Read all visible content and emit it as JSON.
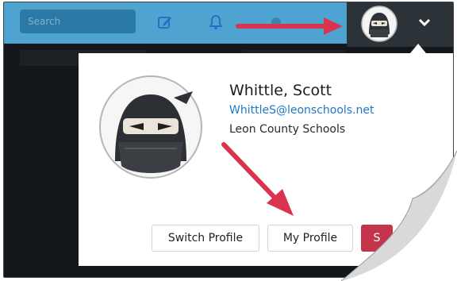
{
  "topbar": {
    "search_placeholder": "Search"
  },
  "profile": {
    "name": "Whittle, Scott",
    "email": "WhittleS@leonschools.net",
    "organization": "Leon County Schools"
  },
  "buttons": {
    "switch_profile": "Switch Profile",
    "my_profile": "My Profile",
    "third": "S"
  },
  "icons": [
    "edit-icon",
    "bell-icon",
    "chevron-down-icon"
  ],
  "colors": {
    "topbar": "#4fa3d1",
    "accent_link": "#1f78c4",
    "annotation_arrow": "#d8344f",
    "danger_button": "#c4344a"
  }
}
